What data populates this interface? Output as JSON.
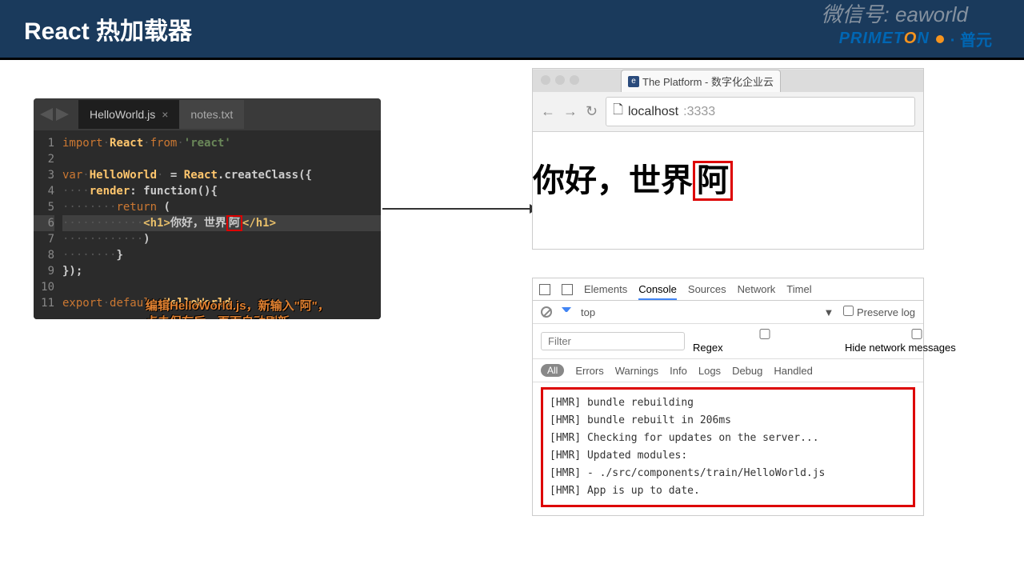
{
  "slide": {
    "title": "React 热加载器"
  },
  "editor": {
    "tabs": [
      {
        "label": "HelloWorld.js",
        "active": true,
        "close": "×"
      },
      {
        "label": "notes.txt",
        "active": false
      }
    ],
    "lineNumbers": [
      "1",
      "2",
      "3",
      "4",
      "5",
      "6",
      "7",
      "8",
      "9",
      "10",
      "11"
    ],
    "code": {
      "l1_import": "import",
      "l1_react": "React",
      "l1_from": "from",
      "l1_pkg": "'react'",
      "l3_var": "var",
      "l3_name": "HelloWorld",
      "l3_eq": " = ",
      "l3_react": "React",
      "l3_create": ".createClass({",
      "l4_render": "render",
      "l4_fn": ": function(){",
      "l5_return": "return",
      "l5_paren": " (",
      "l6_open": "<h1>",
      "l6_txt": "你好，世界",
      "l6_hl": "阿",
      "l6_close": "</h1>",
      "l7": ")",
      "l8": "}",
      "l9": "});",
      "l11_export": "export",
      "l11_default": "default",
      "l11_name": "HelloWorld"
    },
    "annotation_line1": "编辑HelloWorld.js，新输入\"阿\"，",
    "annotation_line2": "点击保存后，页面自动刷新"
  },
  "browser": {
    "tabTitle": "The Platform - 数字化企业云",
    "urlHost": "localhost",
    "urlPort": ":3333",
    "pageHeading_a": "你好，世界",
    "pageHeading_hl": "阿"
  },
  "devtools": {
    "tabs": {
      "elements": "Elements",
      "console": "Console",
      "sources": "Sources",
      "network": "Network",
      "timeline": "Timel"
    },
    "context": "top",
    "preserve": "Preserve log",
    "filter_placeholder": "Filter",
    "regex": "Regex",
    "hide": "Hide network messages",
    "level_all": "All",
    "level_errors": "Errors",
    "level_warnings": "Warnings",
    "level_info": "Info",
    "level_logs": "Logs",
    "level_debug": "Debug",
    "level_handled": "Handled",
    "console": [
      "[HMR] bundle rebuilding",
      "[HMR] bundle rebuilt in 206ms",
      "[HMR] Checking for updates on the server...",
      "[HMR] Updated modules:",
      "[HMR]  - ./src/components/train/HelloWorld.js",
      "[HMR] App is up to date."
    ]
  },
  "footer": {
    "watermark": "微信号: eaworld",
    "logo_a": "PRIMET",
    "logo_b": "O",
    "logo_c": "N",
    "logo_cn": "· 普元"
  }
}
